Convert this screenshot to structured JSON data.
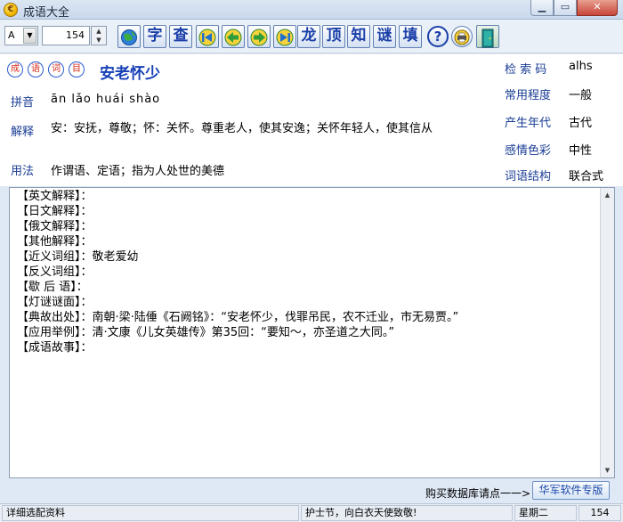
{
  "window": {
    "title": "成语大全",
    "app_icon_glyph": "€",
    "min_label": "▁",
    "max_label": "▭",
    "close_label": "✕"
  },
  "toolbar": {
    "combo_value": "A",
    "combo_arrow": "▼",
    "spin_value": "154",
    "spin_up": "▲",
    "spin_down": "▼",
    "char_buttons": {
      "zi": "字",
      "cha": "查",
      "long": "龙",
      "ding": "顶",
      "zhi": "知",
      "mi": "谜",
      "tian": "填"
    },
    "help_label": "?",
    "icons": [
      "globe-icon",
      "first-icon",
      "previous-icon",
      "next-icon",
      "last-icon",
      "help-icon",
      "printer-icon",
      "exit-door-icon"
    ]
  },
  "entry": {
    "seals": [
      "成",
      "语",
      "词",
      "目"
    ],
    "idiom": "安老怀少",
    "pinyin_label": "拼音",
    "pinyin": "ān  lǎo  huái  shào",
    "explain_label": "解释",
    "explain": "安：安抚，尊敬；怀：关怀。尊重老人，使其安逸；关怀年轻人，使其信从",
    "usage_label": "用法",
    "usage": "作谓语、定语；指为人处世的美德"
  },
  "side": [
    {
      "label": "检 索 码",
      "value": "alhs"
    },
    {
      "label": "常用程度",
      "value": "一般"
    },
    {
      "label": "产生年代",
      "value": "古代"
    },
    {
      "label": "感情色彩",
      "value": "中性"
    },
    {
      "label": "词语结构",
      "value": "联合式"
    }
  ],
  "details": [
    "【英文解释】：",
    "【日文解释】：",
    "【俄文解释】：",
    "【其他解释】：",
    "【近义词组】：敬老爱幼",
    "【反义词组】：",
    "【歇 后 语】：",
    "【灯谜谜面】：",
    "【典故出处】：南朝·梁·陆倕《石阙铭》：“安老怀少，伐罪吊民，农不迁业，市无易贾。”",
    "【应用举例】：清·文康《儿女英雄传》第35回：“要知～，亦圣道之大同。”",
    "【成语故事】："
  ],
  "scroll": {
    "up": "▲",
    "down": "▼"
  },
  "bottom": {
    "buy_text": "购买数据库请点一一>",
    "brand_button": "华军软件专版"
  },
  "status": {
    "left": "详细选配资料",
    "middle": "护士节，向白衣天使致敬!",
    "weekday": "星期二",
    "count": "154"
  }
}
